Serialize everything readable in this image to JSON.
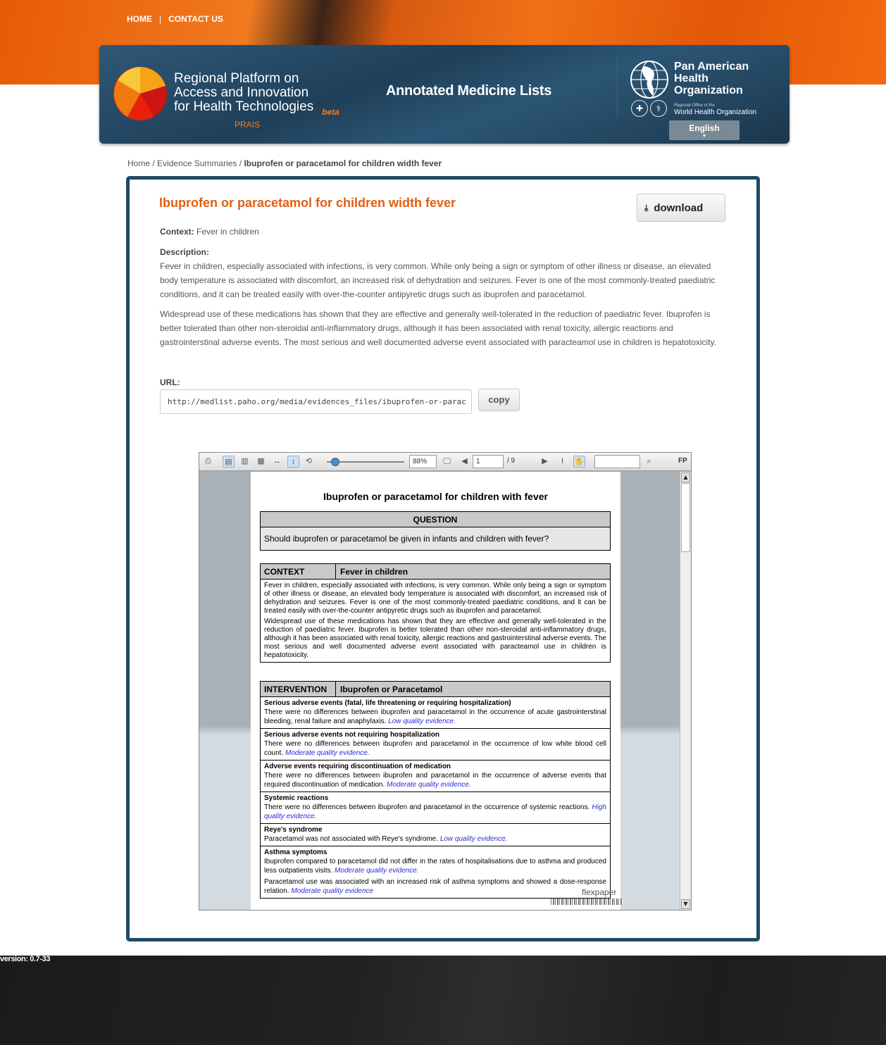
{
  "nav": {
    "home": "HOME",
    "separator": "|",
    "contact": "CONTACT US"
  },
  "header": {
    "platform_title_lines": [
      "Regional Platform on",
      "Access and Innovation",
      "for Health Technologies"
    ],
    "beta": "beta",
    "prais": "PRAIS",
    "app_title": "Annotated Medicine Lists",
    "org_name_lines": [
      "Pan American",
      "Health",
      "Organization"
    ],
    "who_small": "Regional Office of the",
    "who_name": "World Health Organization",
    "language": "English",
    "brand_colors": {
      "orange": "#e85a08",
      "navy": "#1f3f59"
    }
  },
  "breadcrumb": {
    "home": "Home",
    "sep": "/",
    "section": "Evidence Summaries",
    "current": "Ibuprofen or paracetamol for children width fever"
  },
  "document": {
    "title": "Ibuprofen or paracetamol for children width fever",
    "download_label": "download",
    "context_label": "Context:",
    "context_value": "Fever in children",
    "description_label": "Description:",
    "description_p1": "Fever in children, especially associated with infections, is very common. While only being a sign or symptom of other illness or disease, an elevated body temperature is associated with discomfort, an increased risk of dehydration and seizures. Fever is one of the most commonly-treated paediatric conditions, and it can be treated easily with over-the-counter antipyretic drugs such as ibuprofen and paracetamol.",
    "description_p2": "Widespread use of these medications has shown that they are effective and generally well-tolerated in the reduction of paediatric fever. Ibuprofen is better tolerated than other non-steroidal anti-inflammatory drugs, although it has been associated with renal toxicity, allergic reactions and gastrointerstinal adverse events. The most serious and well documented adverse event associated with paracteamol use in children is hepatotoxicity.",
    "url_label": "URL:",
    "url_value": "http://medlist.paho.org/media/evidences_files/ibuprofen-or-parac",
    "copy_label": "copy"
  },
  "viewer": {
    "zoom": "88%",
    "page": "1",
    "total": "/ 9",
    "fp": "FP",
    "brand": "flexpaper",
    "pdf": {
      "title": "Ibuprofen or paracetamol for children with fever",
      "question_header": "QUESTION",
      "question": "Should ibuprofen or paracetamol be given in infants and children with fever?",
      "context_header": "CONTEXT",
      "context_value": "Fever in children",
      "context_p1": "Fever in children, especially associated with infections, is very common. While only being a sign or symptom of other illness or disease, an elevated body temperature is associated with discomfort, an increased risk of dehydration and seizures. Fever is one of the most commonly-treated paediatric conditions, and it can be treated easily with over-the-counter antipyretic drugs such as ibuprofen and paracetamol.",
      "context_p2": "Widespread use of these medications has shown that they are effective and generally well-tolerated in the reduction of paediatric fever. Ibuprofen is better tolerated than other non-steroidal anti-inflammatory drugs, although it has been associated with renal toxicity, allergic reactions and gastrointerstinal adverse events. The most serious and well documented adverse event associated with paracteamol use in children is hepatotoxicity.",
      "intervention_header": "INTERVENTION",
      "intervention_value": "Ibuprofen or Paracetamol",
      "rows": [
        {
          "heading": "Serious adverse events (fatal, life threatening or requiring hospitalization)",
          "text": "There were no differences between ibuprofen and paracetamol in the occurrence of acute gastrointerstinal bleeding, renal failure and anaphylaxis.",
          "evidence": "Low quality evidence."
        },
        {
          "heading": "Serious adverse events not requiring hospitalization",
          "text": "There were no differences between ibuprofen and paracetamol in the occurrence of low white blood cell count.",
          "evidence": "Moderate quality evidence."
        },
        {
          "heading": "Adverse events requiring discontinuation of medication",
          "text": "There were no differences between ibuprofen and paracetamol in the occurrence of adverse events that required discontinuation of medication.",
          "evidence": "Moderate quality evidence."
        },
        {
          "heading": "Systemic reactions",
          "text": "There were no differences between ibuprofen and paracetamol in the occurrence of systemic reactions.",
          "evidence": "High quality evidence."
        },
        {
          "heading": "Reye's syndrome",
          "text": "Paracetamol was not associated with Reye's syndrome.",
          "evidence": "Low quality evidence."
        },
        {
          "heading": "Asthma symptoms",
          "text": "Ibuprofen compared to paracetamol did not differ in the rates of hospitalisations due to asthma and produced less outpatients visits.",
          "evidence": "Moderate quality evidence.",
          "text2": "Paracetamol use was associated with an increased risk of asthma symptoms and showed a dose-response relation.",
          "evidence2": "Moderate quality evidence"
        }
      ]
    }
  },
  "footer": {
    "version": "version: 0.7-33"
  }
}
